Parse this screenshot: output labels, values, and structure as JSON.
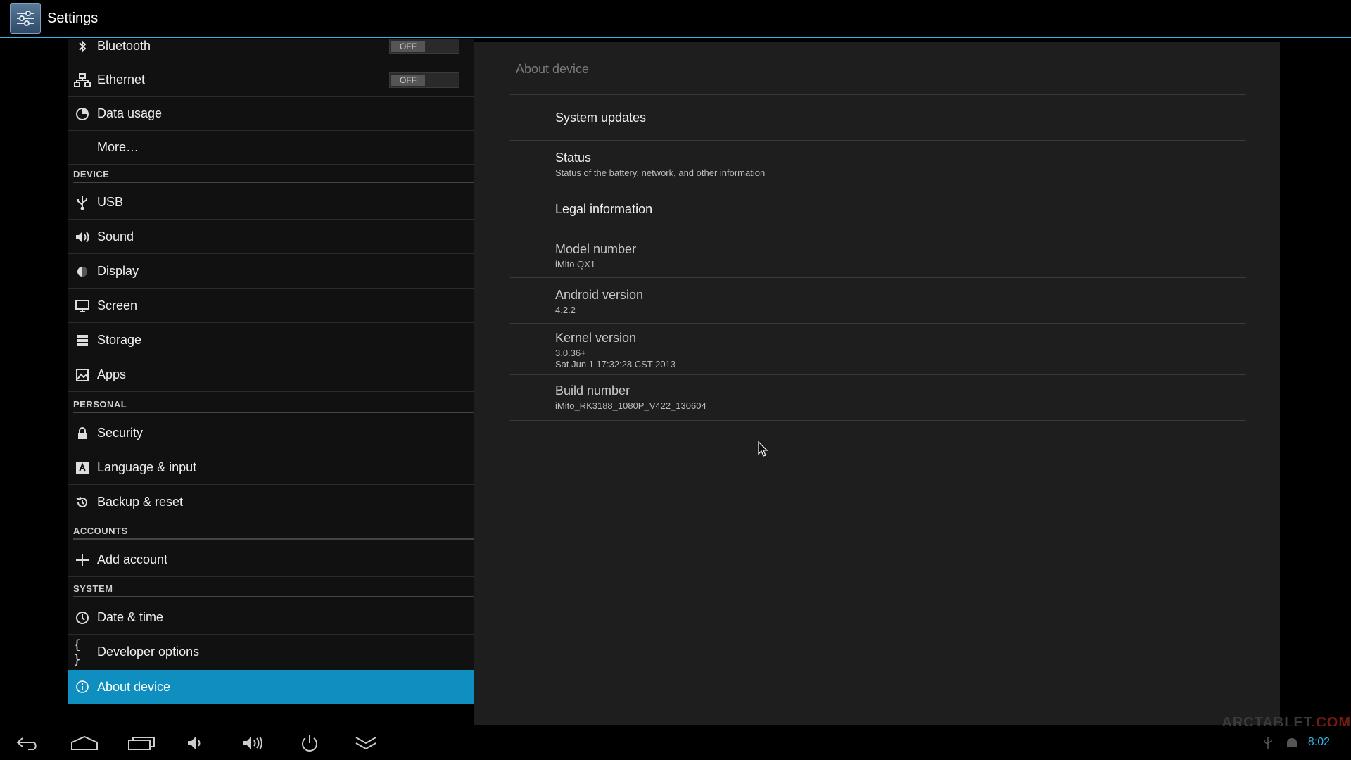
{
  "app": {
    "title": "Settings"
  },
  "sidebar": {
    "rows": [
      {
        "label": "Bluetooth",
        "icon": "bluetooth-icon",
        "toggle": "OFF"
      },
      {
        "label": "Ethernet",
        "icon": "ethernet-icon",
        "toggle": "OFF"
      },
      {
        "label": "Data usage",
        "icon": "data-usage-icon"
      },
      {
        "label": "More…",
        "icon": ""
      },
      {
        "label": "USB",
        "icon": "usb-icon"
      },
      {
        "label": "Sound",
        "icon": "sound-icon"
      },
      {
        "label": "Display",
        "icon": "display-icon"
      },
      {
        "label": "Screen",
        "icon": "screen-icon"
      },
      {
        "label": "Storage",
        "icon": "storage-icon"
      },
      {
        "label": "Apps",
        "icon": "apps-icon"
      },
      {
        "label": "Security",
        "icon": "lock-icon"
      },
      {
        "label": "Language & input",
        "icon": "language-icon"
      },
      {
        "label": "Backup & reset",
        "icon": "backup-icon"
      },
      {
        "label": "Add account",
        "icon": "plus-icon"
      },
      {
        "label": "Date & time",
        "icon": "clock-icon"
      },
      {
        "label": "Developer options",
        "icon": "braces-icon"
      },
      {
        "label": "About device",
        "icon": "info-icon",
        "selected": true
      }
    ],
    "sections": {
      "device": "DEVICE",
      "personal": "PERSONAL",
      "accounts": "ACCOUNTS",
      "system": "SYSTEM"
    }
  },
  "detail": {
    "title": "About device",
    "items": [
      {
        "title": "System updates"
      },
      {
        "title": "Status",
        "summary": "Status of the battery, network, and other information"
      },
      {
        "title": "Legal information"
      },
      {
        "title": "Model number",
        "summary": "iMito QX1"
      },
      {
        "title": "Android version",
        "summary": "4.2.2"
      },
      {
        "title": "Kernel version",
        "summary": "3.0.36+\nSat Jun 1 17:32:28 CST 2013"
      },
      {
        "title": "Build number",
        "summary": "iMito_RK3188_1080P_V422_130604"
      }
    ]
  },
  "navbar": {
    "buttons": [
      "back-icon",
      "home-icon",
      "recent-apps-icon",
      "volume-down-icon",
      "volume-up-icon",
      "power-icon",
      "hide-bar-icon"
    ],
    "clock": "8:02",
    "watermark_main": "ARCTABLET",
    "watermark_suffix": ".COM"
  },
  "colors": {
    "accent": "#33b5e5",
    "selected": "#0f8fc0"
  }
}
